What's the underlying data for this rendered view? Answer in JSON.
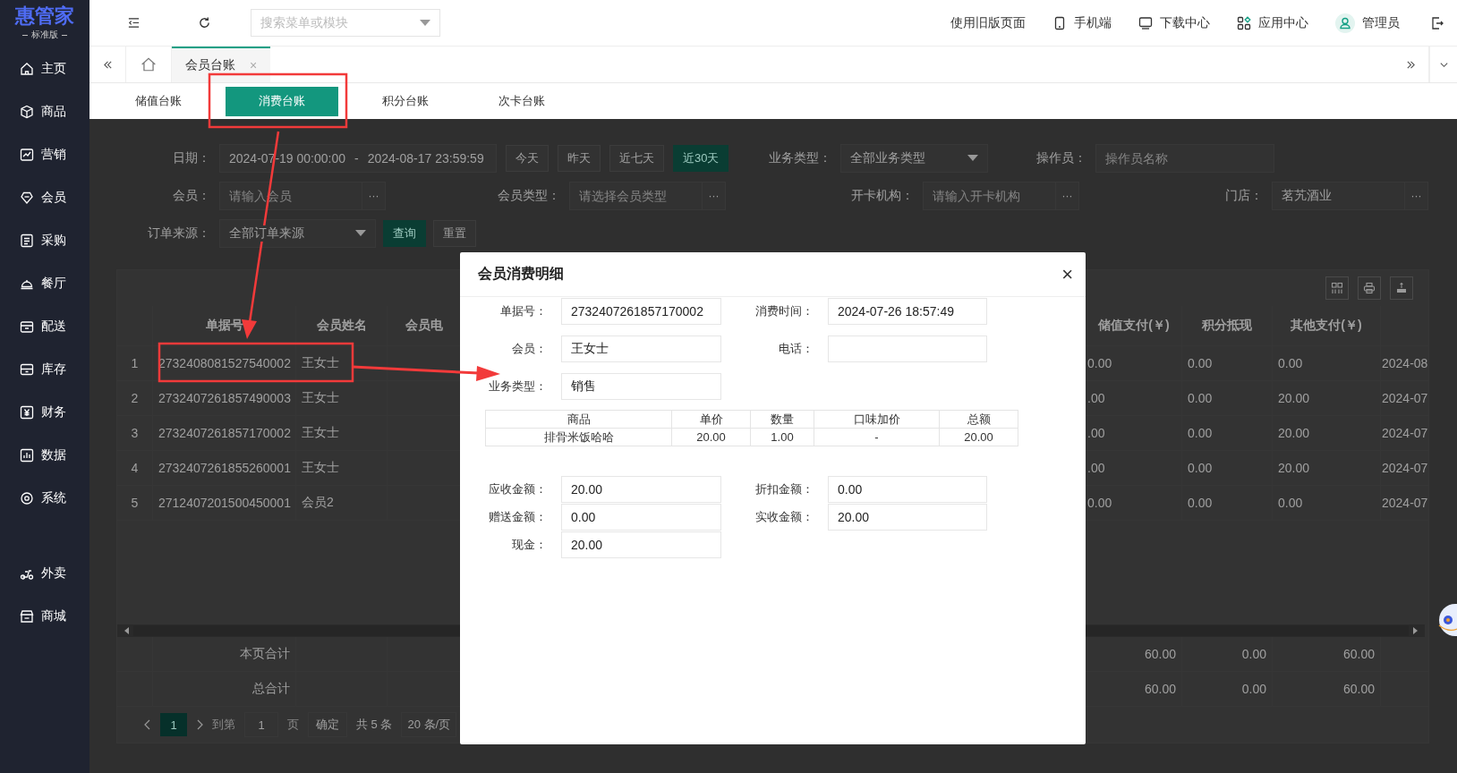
{
  "sidebar": {
    "logo": "惠管家",
    "edition": "标准版",
    "menus": [
      [
        {
          "label": "主页"
        },
        {
          "label": "商品"
        },
        {
          "label": "营销"
        },
        {
          "label": "会员"
        },
        {
          "label": "采购"
        },
        {
          "label": "餐厅"
        },
        {
          "label": "配送"
        },
        {
          "label": "库存"
        },
        {
          "label": "财务"
        },
        {
          "label": "数据"
        },
        {
          "label": "系统"
        }
      ],
      [
        {
          "label": "外卖"
        },
        {
          "label": "商城"
        }
      ]
    ]
  },
  "topbar": {
    "search": {
      "placeholder": "搜索菜单或模块"
    },
    "links": [
      {
        "label": "使用旧版页面"
      },
      {
        "label": "手机端"
      },
      {
        "label": "下载中心"
      },
      {
        "label": "应用中心"
      }
    ],
    "user": "管理员"
  },
  "page_tabs": [
    {
      "label": "会员台账",
      "selected": true,
      "close": "×"
    }
  ],
  "subtabs": [
    {
      "label": "储值台账",
      "selected": false
    },
    {
      "label": "消费台账",
      "selected": true
    },
    {
      "label": "积分台账",
      "selected": false
    },
    {
      "label": "次卡台账",
      "selected": false
    }
  ],
  "filters": {
    "date": {
      "label": "日期：",
      "start": "2024-07-19 00:00:00",
      "separator": "-",
      "end": "2024-08-17 23:59:59"
    },
    "quick_ranges": [
      {
        "label": "今天",
        "selected": false
      },
      {
        "label": "昨天",
        "selected": false
      },
      {
        "label": "近七天",
        "selected": false
      },
      {
        "label": "近30天",
        "selected": true
      }
    ],
    "business_type": {
      "label": "业务类型：",
      "value": "全部业务类型"
    },
    "operator": {
      "label": "操作员：",
      "placeholder": "操作员名称"
    },
    "lookups": [
      {
        "label": "会员：",
        "placeholder": "请输入会员",
        "button": "···"
      },
      {
        "label": "会员类型：",
        "placeholder": "请选择会员类型",
        "button": "···"
      },
      {
        "label": "开卡机构：",
        "placeholder": "请输入开卡机构",
        "button": "···"
      },
      {
        "label": "门店：",
        "value": "茗艽酒业",
        "button": "···"
      }
    ],
    "order_source": {
      "label": "订单来源：",
      "value": "全部订单来源"
    },
    "actions": [
      "查询",
      "重置"
    ]
  },
  "table": {
    "left_columns": [
      "单据号",
      "会员姓名",
      "会员电"
    ],
    "right_columns": [
      "储值支付(￥)",
      "积分抵现",
      "其他支付(￥)"
    ],
    "rows": [
      {
        "index": "1",
        "order_no": "2732408081527540002",
        "member": "王女士",
        "stored": "0.00",
        "points": "0.00",
        "other": "0.00",
        "date": "2024-08"
      },
      {
        "index": "2",
        "order_no": "2732407261857490003",
        "member": "王女士",
        "stored": ".00",
        "points": "0.00",
        "other": "20.00",
        "date": "2024-07"
      },
      {
        "index": "3",
        "order_no": "2732407261857170002",
        "member": "王女士",
        "stored": ".00",
        "points": "0.00",
        "other": "20.00",
        "date": "2024-07"
      },
      {
        "index": "4",
        "order_no": "2732407261855260001",
        "member": "王女士",
        "stored": ".00",
        "points": "0.00",
        "other": "20.00",
        "date": "2024-07"
      },
      {
        "index": "5",
        "order_no": "2712407201500450001",
        "member": "会员2",
        "stored": "0.00",
        "points": "0.00",
        "other": "0.00",
        "date": "2024-07"
      }
    ],
    "totals": [
      {
        "label": "本页合计",
        "stored": "60.00",
        "points": "0.00",
        "other": "60.00"
      },
      {
        "label": "总合计",
        "stored": "60.00",
        "points": "0.00",
        "other": "60.00"
      }
    ]
  },
  "pagination": {
    "pages": [
      {
        "label": "1",
        "selected": true
      }
    ],
    "goto_label": "到第",
    "goto_value": "1",
    "page_unit": "页",
    "confirm": "确定",
    "total": "共 5 条",
    "page_size": "20 条/页"
  },
  "modal": {
    "title": "会员消费明细",
    "close": "×",
    "fields": [
      {
        "label": "单据号：",
        "value": "2732407261857170002"
      },
      {
        "label": "消费时间：",
        "value": "2024-07-26 18:57:49"
      },
      {
        "label": "会员：",
        "value": "王女士"
      },
      {
        "label": "电话："
      },
      {
        "label": "业务类型：",
        "value": "销售"
      }
    ],
    "items": {
      "columns": [
        "商品",
        "单价",
        "数量",
        "口味加价",
        "总额"
      ],
      "rows": [
        [
          "排骨米饭哈哈",
          "20.00",
          "1.00",
          "-",
          "20.00"
        ]
      ]
    },
    "amounts": [
      {
        "label": "应收金额：",
        "value": "20.00"
      },
      {
        "label": "折扣金额：",
        "value": "0.00"
      },
      {
        "label": "赠送金额：",
        "value": "0.00"
      },
      {
        "label": "实收金额：",
        "value": "20.00"
      },
      {
        "label": "现金：",
        "value": "20.00"
      }
    ]
  }
}
